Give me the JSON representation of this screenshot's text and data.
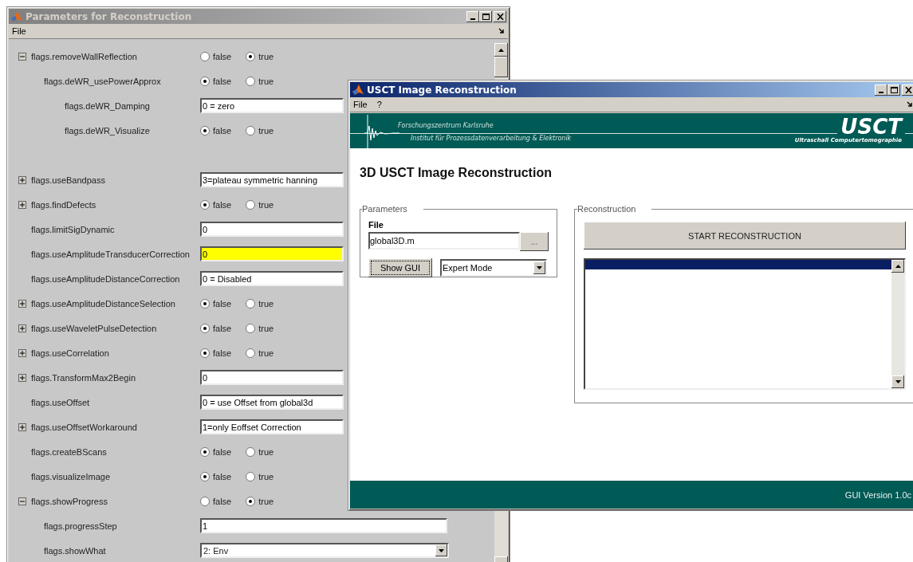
{
  "param_window": {
    "title": "Parameters for Reconstruction",
    "active": false,
    "menu": [
      "File"
    ],
    "rows": [
      {
        "label": "flags.removeWallReflection",
        "kind": "radio",
        "expanded": true,
        "options": [
          {
            "label": "false",
            "selected": false
          },
          {
            "label": "true",
            "selected": true
          }
        ],
        "children": [
          {
            "label": "flags.deWR_usePowerApprox",
            "kind": "radio",
            "options": [
              {
                "label": "false",
                "selected": true
              },
              {
                "label": "true",
                "selected": false
              }
            ],
            "children": [
              {
                "label": "flags.deWR_Damping",
                "kind": "text",
                "value": "0 = zero",
                "highlighted": false
              },
              {
                "label": "flags.deWR_Visualize",
                "kind": "radio",
                "options": [
                  {
                    "label": "false",
                    "selected": true
                  },
                  {
                    "label": "true",
                    "selected": false
                  }
                ]
              }
            ]
          }
        ]
      },
      {
        "label": "flags.useBandpass",
        "kind": "text",
        "expanded": false,
        "value": "3=plateau symmetric hanning",
        "highlighted": false
      },
      {
        "label": "flags.findDefects",
        "kind": "radio",
        "expanded": false,
        "options": [
          {
            "label": "false",
            "selected": true
          },
          {
            "label": "true",
            "selected": false
          }
        ]
      },
      {
        "label": "flags.limitSigDynamic",
        "kind": "text",
        "value": "0",
        "highlighted": false
      },
      {
        "label": "flags.useAmplitudeTransducerCorrection",
        "kind": "text",
        "value": "0",
        "highlighted": true
      },
      {
        "label": "flags.useAmplitudeDistanceCorrection",
        "kind": "text",
        "value": "0 = Disabled",
        "highlighted": false
      },
      {
        "label": "flags.useAmplitudeDistanceSelection",
        "kind": "radio",
        "expanded": false,
        "options": [
          {
            "label": "false",
            "selected": true
          },
          {
            "label": "true",
            "selected": false
          }
        ]
      },
      {
        "label": "flags.useWaveletPulseDetection",
        "kind": "radio",
        "expanded": false,
        "options": [
          {
            "label": "false",
            "selected": true
          },
          {
            "label": "true",
            "selected": false
          }
        ]
      },
      {
        "label": "flags.useCorrelation",
        "kind": "radio",
        "expanded": false,
        "options": [
          {
            "label": "false",
            "selected": true
          },
          {
            "label": "true",
            "selected": false
          }
        ]
      },
      {
        "label": "flags.TransformMax2Begin",
        "kind": "text",
        "expanded": false,
        "value": "0",
        "highlighted": false
      },
      {
        "label": "flags.useOffset",
        "kind": "text",
        "value": "0 = use Offset from global3d",
        "highlighted": false
      },
      {
        "label": "flags.useOffsetWorkaround",
        "kind": "text",
        "expanded": false,
        "value": "1=only Eoffset Correction",
        "highlighted": false
      },
      {
        "label": "flags.createBScans",
        "kind": "radio",
        "options": [
          {
            "label": "false",
            "selected": true
          },
          {
            "label": "true",
            "selected": false
          }
        ]
      },
      {
        "label": "flags.visualizeImage",
        "kind": "radio",
        "options": [
          {
            "label": "false",
            "selected": true
          },
          {
            "label": "true",
            "selected": false
          }
        ]
      },
      {
        "label": "flags.showProgress",
        "kind": "radio",
        "expanded": true,
        "options": [
          {
            "label": "false",
            "selected": false
          },
          {
            "label": "true",
            "selected": true
          }
        ],
        "children": [
          {
            "label": "flags.progressStep",
            "kind": "text",
            "value": "1",
            "highlighted": false
          },
          {
            "label": "flags.showWhat",
            "kind": "combo",
            "value": "2: Env"
          }
        ]
      }
    ]
  },
  "usct_window": {
    "title": "USCT Image Reconstruction",
    "active": true,
    "menu": [
      "File",
      "?"
    ],
    "banner": {
      "line_1": "Forschungszentrum Karlsruhe",
      "line_2": "Institut für Prozessdatenverarbeitung & Elektronik",
      "logo": "USCT",
      "subtitle": "Ultraschall Computertomographie"
    },
    "heading": "3D USCT Image Reconstruction",
    "parameters": {
      "title": "Parameters",
      "file_label": "File",
      "file_value": "global3D.m",
      "browse_button": "...",
      "show_button": "Show GUI",
      "mode": "Expert Mode"
    },
    "reconstruction": {
      "title": "Reconstruction",
      "start_button": "START RECONSTRUCTION",
      "log_rows": [
        {
          "selected": true
        }
      ]
    },
    "footer": "GUI Version 1.0c"
  }
}
